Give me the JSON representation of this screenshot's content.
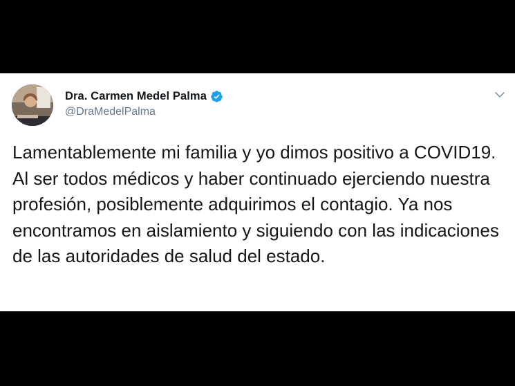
{
  "tweet": {
    "author": {
      "display_name": "Dra. Carmen Medel Palma",
      "handle": "@DraMedelPalma",
      "verified": true
    },
    "text": "Lamentablemente mi familia y yo dimos positivo a COVID19. Al ser todos médicos y haber continuado ejerciendo nuestra profesión, posiblemente adquirimos el contagio. Ya nos encontramos en aislamiento y siguiendo con las indicaciones de las autoridades de salud del estado."
  },
  "icons": {
    "verified": "verified-badge-icon",
    "menu": "chevron-down-icon"
  },
  "colors": {
    "background": "#000000",
    "card": "#ffffff",
    "name_text": "#14171a",
    "handle_text": "#657786",
    "verified_blue": "#1da1f2"
  }
}
